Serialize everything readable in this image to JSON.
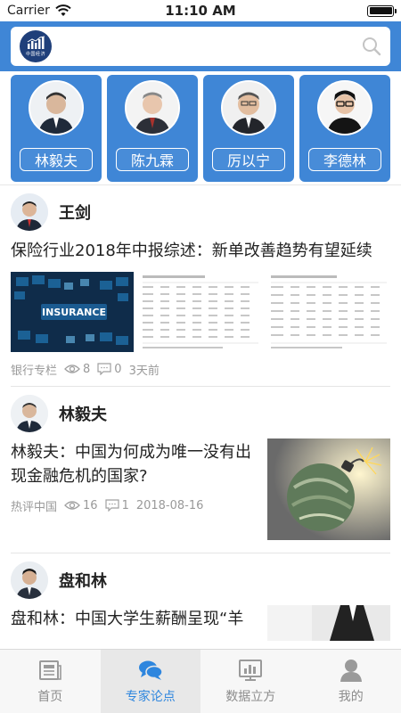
{
  "status_bar": {
    "carrier": "Carrier",
    "time": "11:10 AM"
  },
  "header": {
    "logo_text": "中国经济",
    "search_icon": "search-icon"
  },
  "experts": [
    {
      "name": "林毅夫"
    },
    {
      "name": "陈九霖"
    },
    {
      "name": "厉以宁"
    },
    {
      "name": "李德林"
    }
  ],
  "articles": [
    {
      "author": "王剑",
      "title": "保险行业2018年中报综述：新单改善趋势有望延续",
      "image_text": "INSURANCE",
      "source": "银行专栏",
      "views": "8",
      "comments": "0",
      "time": "3天前"
    },
    {
      "author": "林毅夫",
      "title": "林毅夫：中国为何成为唯一没有出现金融危机的国家?",
      "source": "热评中国",
      "views": "16",
      "comments": "1",
      "time": "2018-08-16"
    },
    {
      "author": "盘和林",
      "title": "盘和林：中国大学生薪酬呈现“羊"
    }
  ],
  "tabs": [
    {
      "label": "首页",
      "icon": "newspaper-icon"
    },
    {
      "label": "专家论点",
      "icon": "chat-bubbles-icon"
    },
    {
      "label": "数据立方",
      "icon": "bar-chart-icon"
    },
    {
      "label": "我的",
      "icon": "user-icon"
    }
  ],
  "colors": {
    "primary": "#3f86d6",
    "active_tab": "#2e86de",
    "meta_text": "#999999"
  }
}
